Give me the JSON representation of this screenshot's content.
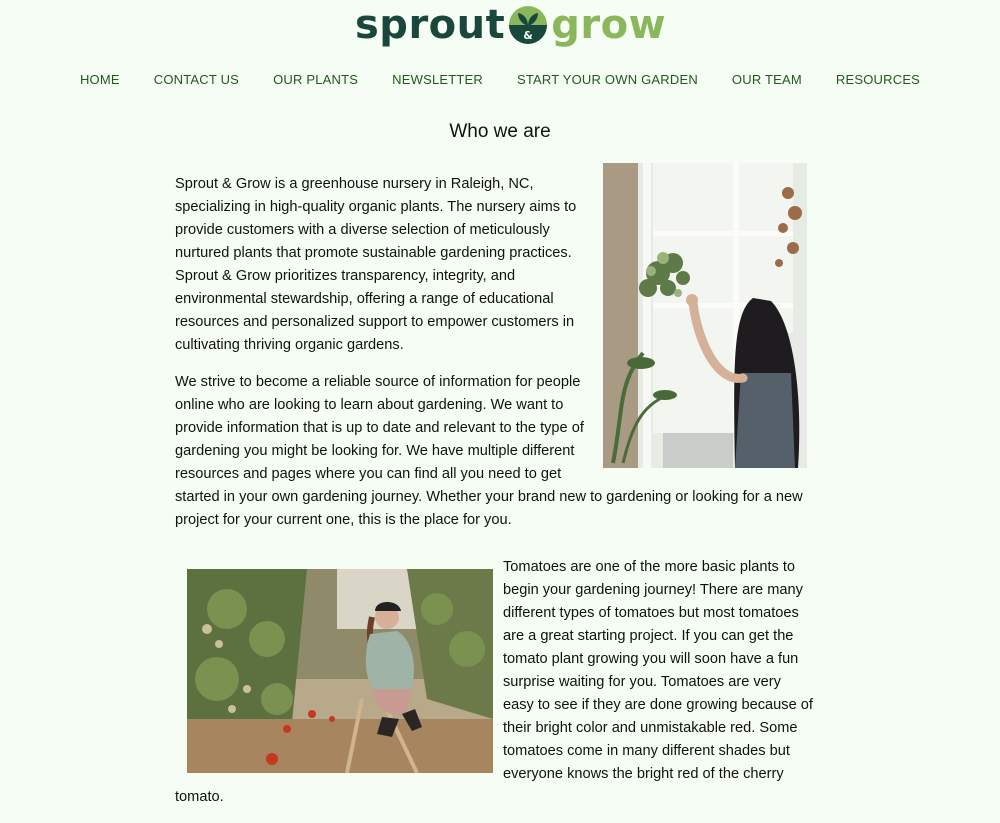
{
  "logo": {
    "word1": "sprout",
    "word2": "grow",
    "mark_icon": "sprout-ampersand-icon",
    "colors": {
      "dark": "#19473c",
      "light": "#8ab65c"
    }
  },
  "nav": {
    "items": [
      "HOME",
      "CONTACT US",
      "OUR PLANTS",
      "NEWSLETTER",
      "START YOUR OWN GARDEN",
      "OUR TEAM",
      "RESOURCES"
    ]
  },
  "main": {
    "heading": "Who we are",
    "paragraph1": "Sprout & Grow is a greenhouse nursery in Raleigh, NC, specializing in high-quality organic plants. The nursery aims to provide customers with a diverse selection of meticulously nurtured plants that promote sustainable gardening practices. Sprout & Grow prioritizes transparency, integrity, and environmental stewardship, offering a range of educational resources and personalized support to empower customers in cultivating thriving organic gardens.",
    "paragraph2": "We strive to become a reliable source of information for people online who are looking to learn about gardening. We want to provide information that is up to date and relevant to the type of gardening you might be looking for. We have multiple different resources and pages where you can find all you need to get started in your own gardening journey. Whether your brand new to gardening or looking for a new project for your current one, this is the place for you.",
    "paragraph3": "Tomatoes are one of the more basic plants to begin your gardening journey! There are many different types of tomatoes but most tomatoes are a great starting project. If you can get the tomato plant growing you will soon have a fun surprise waiting for you. Tomatoes are very easy to see if they are done growing because of their bright color and unmistakable red. Some tomatoes come in many different shades but everyone knows the bright red of the cherry tomato."
  },
  "colors": {
    "background": "#f6fdf4",
    "nav_text": "#1f5a1a"
  }
}
